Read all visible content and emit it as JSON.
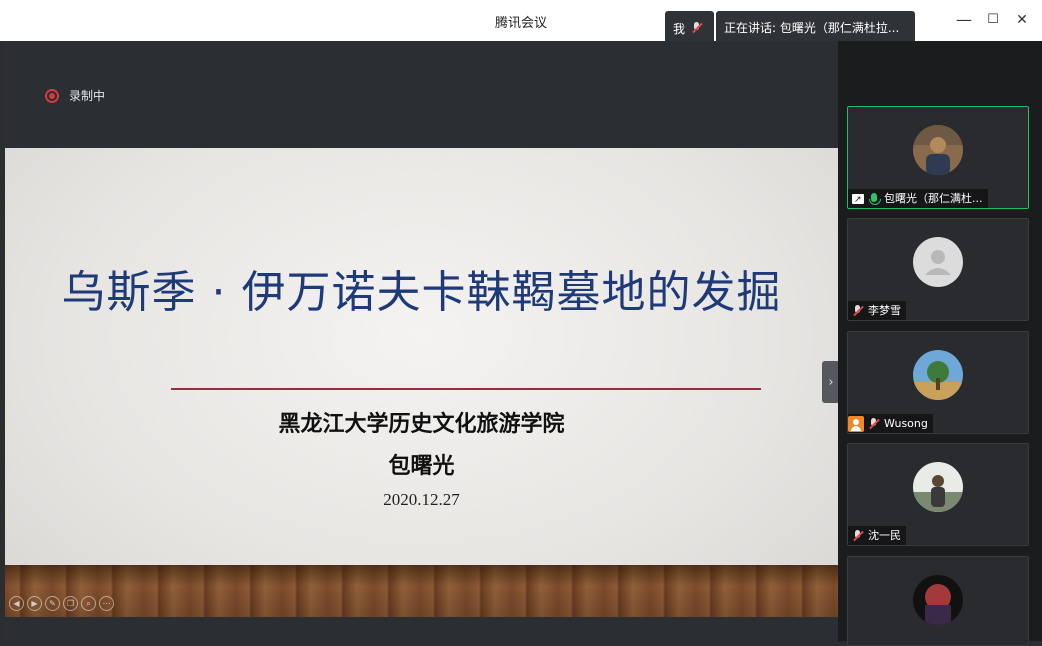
{
  "window": {
    "title": "腾讯会议",
    "minimize": "—",
    "maximize": "☐",
    "close": "✕"
  },
  "status": {
    "me_label": "我",
    "speaking_text": "正在讲话: 包曙光（那仁满杜拉..."
  },
  "recording": {
    "label": "录制中"
  },
  "slide": {
    "title": "乌斯季 · 伊万诺夫卡靺鞨墓地的发掘",
    "institution": "黑龙江大学历史文化旅游学院",
    "presenter": "包曙光",
    "date": "2020.12.27",
    "controls": [
      "◀",
      "▶",
      "✎",
      "❐",
      "⌕",
      "⋯"
    ]
  },
  "panel": {
    "collapse_icon": "›",
    "participants": [
      {
        "name": "包曙光（那仁满杜...",
        "mic": "on",
        "sharing": true,
        "host": false,
        "active": true,
        "avatar_colors": [
          "#8a6a4c",
          "#b38b5a",
          "#2f3b52"
        ]
      },
      {
        "name": "李梦雪",
        "mic": "off",
        "sharing": false,
        "host": false,
        "active": false,
        "avatar_colors": [
          "#dcdcdc",
          "#b8b8b8",
          "#b8b8b8"
        ]
      },
      {
        "name": "Wusong",
        "mic": "off",
        "sharing": false,
        "host": true,
        "active": false,
        "avatar_colors": [
          "#6fa7d8",
          "#3e7a3a",
          "#c9a15a"
        ]
      },
      {
        "name": "沈一民",
        "mic": "off",
        "sharing": false,
        "host": false,
        "active": false,
        "avatar_colors": [
          "#e8ebe6",
          "#5a4632",
          "#7a8a70"
        ]
      },
      {
        "name": "",
        "mic": "off",
        "sharing": false,
        "host": false,
        "active": false,
        "avatar_colors": [
          "#111111",
          "#a23a3a",
          "#3a2a48"
        ]
      }
    ]
  },
  "colors": {
    "active_border": "#1fbf6a",
    "title_blue": "#1f3a78",
    "rule_red": "#9e2a40",
    "recording_red": "#d23b3b"
  }
}
